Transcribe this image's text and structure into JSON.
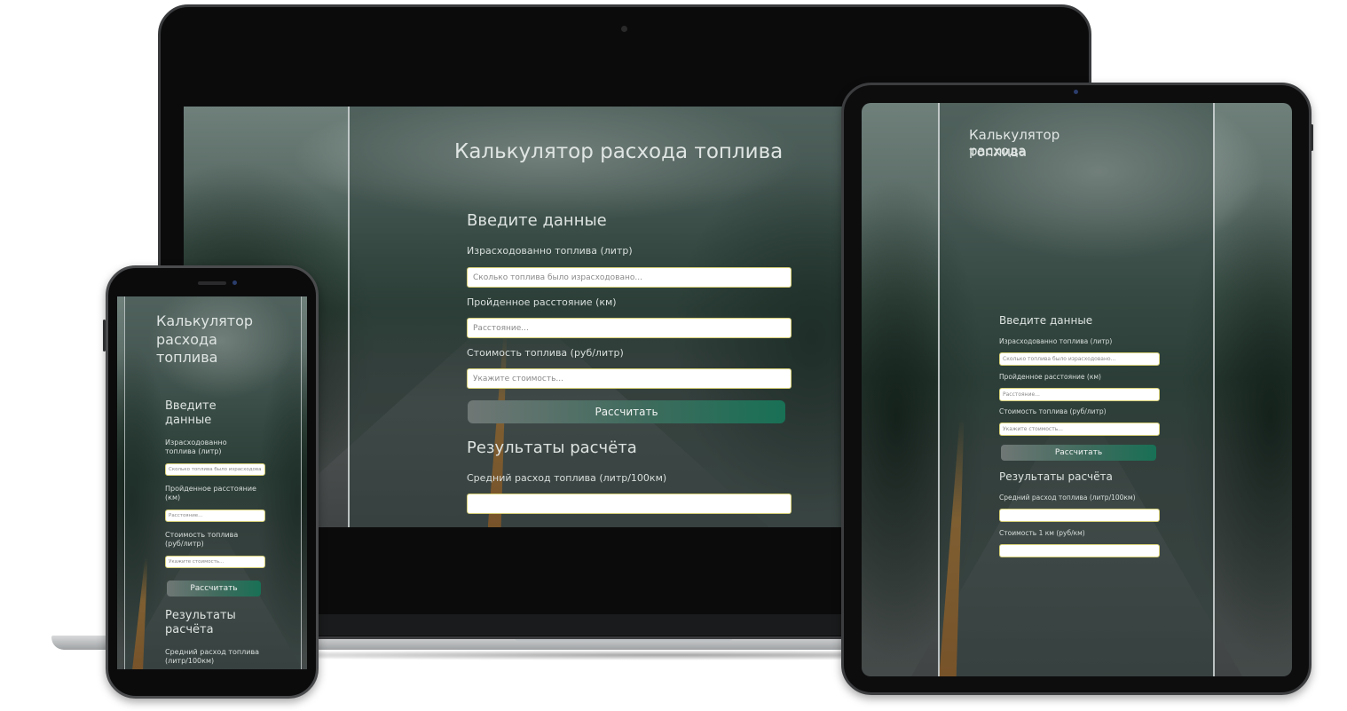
{
  "laptop": {
    "title": "Калькулятор расхода топлива",
    "input_heading": "Введите данные",
    "fuel_label": "Израсходованно топлива (литр)",
    "fuel_placeholder": "Сколько топлива было израсходовано...",
    "distance_label": "Пройденное расстояние (км)",
    "distance_placeholder": "Расстояние...",
    "price_label": "Стоимость топлива (руб/литр)",
    "price_placeholder": "Укажите стоимость...",
    "button": "Рассчитать",
    "results_heading": "Результаты расчёта",
    "avg_label": "Средний расход топлива (литр/100км)"
  },
  "tablet": {
    "title_line1": "Калькулятор расхода",
    "title_line2": "топлива",
    "input_heading": "Введите данные",
    "fuel_label": "Израсходованно топлива (литр)",
    "fuel_placeholder": "Сколько топлива было израсходовано...",
    "distance_label": "Пройденное расстояние (км)",
    "distance_placeholder": "Расстояние...",
    "price_label": "Стоимость топлива (руб/литр)",
    "price_placeholder": "Укажите стоимость...",
    "button": "Рассчитать",
    "results_heading": "Результаты расчёта",
    "avg_label": "Средний расход топлива (литр/100км)",
    "km_cost_label": "Стоимость 1 км (руб/км)"
  },
  "phone": {
    "title_line1": "Калькулятор",
    "title_line2": "расхода",
    "title_line3": "топлива",
    "input_heading_line1": "Введите",
    "input_heading_line2": "данные",
    "fuel_label_line1": "Израсходованно",
    "fuel_label_line2": "топлива (литр)",
    "fuel_placeholder": "Сколько топлива было израсходова",
    "distance_label_line1": "Пройденное расстояние",
    "distance_label_line2": "(км)",
    "distance_placeholder": "Расстояние...",
    "price_label_line1": "Стоимость топлива",
    "price_label_line2": "(руб/литр)",
    "price_placeholder": "Укажите стоимость...",
    "button": "Рассчитать",
    "results_heading_line1": "Результаты",
    "results_heading_line2": "расчёта",
    "avg_label_line1": "Средний расход топлива",
    "avg_label_line2": "(литр/100км)"
  }
}
